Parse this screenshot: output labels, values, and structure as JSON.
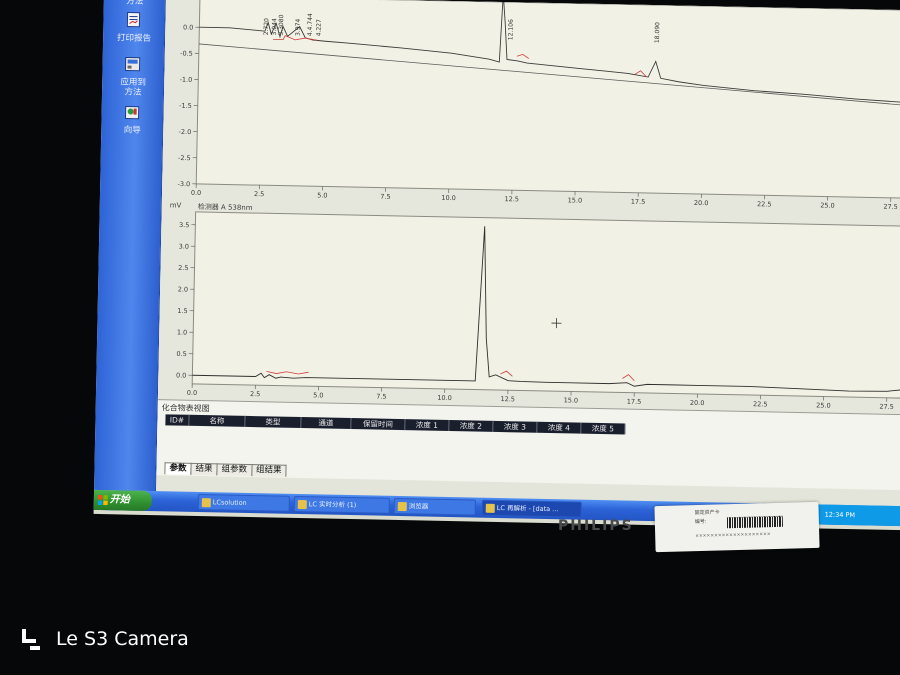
{
  "sidebar": {
    "items": [
      {
        "label": "打印报告",
        "icon": "report-icon"
      },
      {
        "label": "应用到\n方法",
        "icon": "apply-method-icon"
      },
      {
        "label": "向导",
        "icon": "wizard-icon"
      }
    ],
    "top_partial_label": "方法"
  },
  "top_chart": {
    "ylabel": "",
    "y_ticks": [
      "0.0",
      "-0.5",
      "-1.0",
      "-1.5",
      "-2.0",
      "-2.5",
      "-3.0"
    ],
    "x_ticks": [
      "0.0",
      "2.5",
      "5.0",
      "7.5",
      "10.0",
      "12.5",
      "15.0",
      "17.5",
      "20.0",
      "22.5",
      "25.0",
      "27.5"
    ],
    "peak_labels": [
      "2.720",
      "3.044",
      "3.3080",
      "3.974",
      "4.4.744",
      "4.227",
      "12.106",
      "18.090"
    ]
  },
  "bottom_chart": {
    "ylabel": "mV",
    "channel_label": "检测器 A 538nm",
    "y_ticks": [
      "3.5",
      "3.0",
      "2.5",
      "2.0",
      "1.5",
      "1.0",
      "0.5",
      "0.0"
    ],
    "x_ticks": [
      "0.0",
      "2.5",
      "5.0",
      "7.5",
      "10.0",
      "12.5",
      "15.0",
      "17.5",
      "20.0",
      "22.5",
      "25.0",
      "27.5"
    ]
  },
  "compound_panel": {
    "title": "化合物表视图",
    "columns": [
      "ID#",
      "名称",
      "类型",
      "通道",
      "保留时间",
      "浓度 1",
      "浓度 2",
      "浓度 3",
      "浓度 4",
      "浓度 5"
    ]
  },
  "sheet_tabs": [
    "参数",
    "结果",
    "组参数",
    "组结果"
  ],
  "taskbar": {
    "start_label": "开始",
    "items": [
      {
        "label": "LCsolution"
      },
      {
        "label": "LC 实时分析 (1)"
      },
      {
        "label": "浏览器"
      },
      {
        "label": "LC 再解析 - [data ..."
      }
    ],
    "tray_text": "12:34 PM"
  },
  "bezel_brand": "PHILIPS",
  "sticker": {
    "line1": "固定资产卡",
    "line2": "编号:",
    "line3": "××××××××××××××××××××"
  },
  "camera_watermark": "Le S3 Camera",
  "chart_data": [
    {
      "type": "line",
      "title": "",
      "xlabel": "",
      "ylabel": "",
      "xlim": [
        0,
        28.5
      ],
      "ylim": [
        -3.0,
        0.6
      ],
      "grid": false,
      "series": [
        {
          "x": [
            0,
            1.2,
            2.6,
            2.72,
            2.85,
            3.04,
            3.2,
            3.31,
            3.5,
            3.97,
            4.2,
            4.5,
            5,
            6,
            8,
            10,
            11.5,
            11.9,
            12.0,
            12.1,
            12.2,
            12.6,
            13,
            14,
            15,
            16,
            17,
            17.8,
            18.09,
            18.3,
            19,
            20,
            22,
            24,
            26,
            28.5
          ],
          "y": [
            0.0,
            0.0,
            -0.05,
            0.12,
            -0.1,
            0.1,
            -0.15,
            0.05,
            -0.14,
            0.05,
            -0.16,
            -0.2,
            -0.22,
            -0.25,
            -0.32,
            -0.4,
            -0.5,
            -0.55,
            2.5,
            0.2,
            -0.5,
            -0.52,
            -0.56,
            -0.6,
            -0.64,
            -0.68,
            -0.72,
            -0.78,
            -0.48,
            -0.8,
            -0.86,
            -0.92,
            -1.0,
            -1.05,
            -1.12,
            -1.18
          ]
        }
      ]
    },
    {
      "type": "line",
      "title": "",
      "xlabel": "",
      "ylabel": "mV",
      "xlim": [
        0,
        28.5
      ],
      "ylim": [
        -0.2,
        3.8
      ],
      "grid": false,
      "series": [
        {
          "name": "检测器 A 538nm",
          "x": [
            0,
            1,
            2.5,
            2.72,
            2.85,
            3.04,
            3.3,
            3.5,
            4,
            4.5,
            5,
            7.5,
            10,
            11.2,
            11.45,
            11.6,
            11.75,
            12.0,
            12.5,
            13,
            14,
            15,
            16.5,
            17.2,
            17.5,
            18,
            19,
            20,
            22,
            24,
            26,
            27.5,
            28.5
          ],
          "y": [
            0.0,
            0.0,
            0.0,
            0.08,
            -0.02,
            0.05,
            -0.03,
            0.0,
            -0.02,
            0.0,
            0.0,
            0.0,
            0.0,
            0.0,
            3.6,
            1.0,
            0.1,
            0.15,
            0.02,
            0.01,
            0.0,
            0.0,
            0.0,
            0.03,
            -0.05,
            0.0,
            0.0,
            0.0,
            0.0,
            -0.03,
            -0.06,
            -0.05,
            0.02
          ]
        }
      ]
    }
  ]
}
